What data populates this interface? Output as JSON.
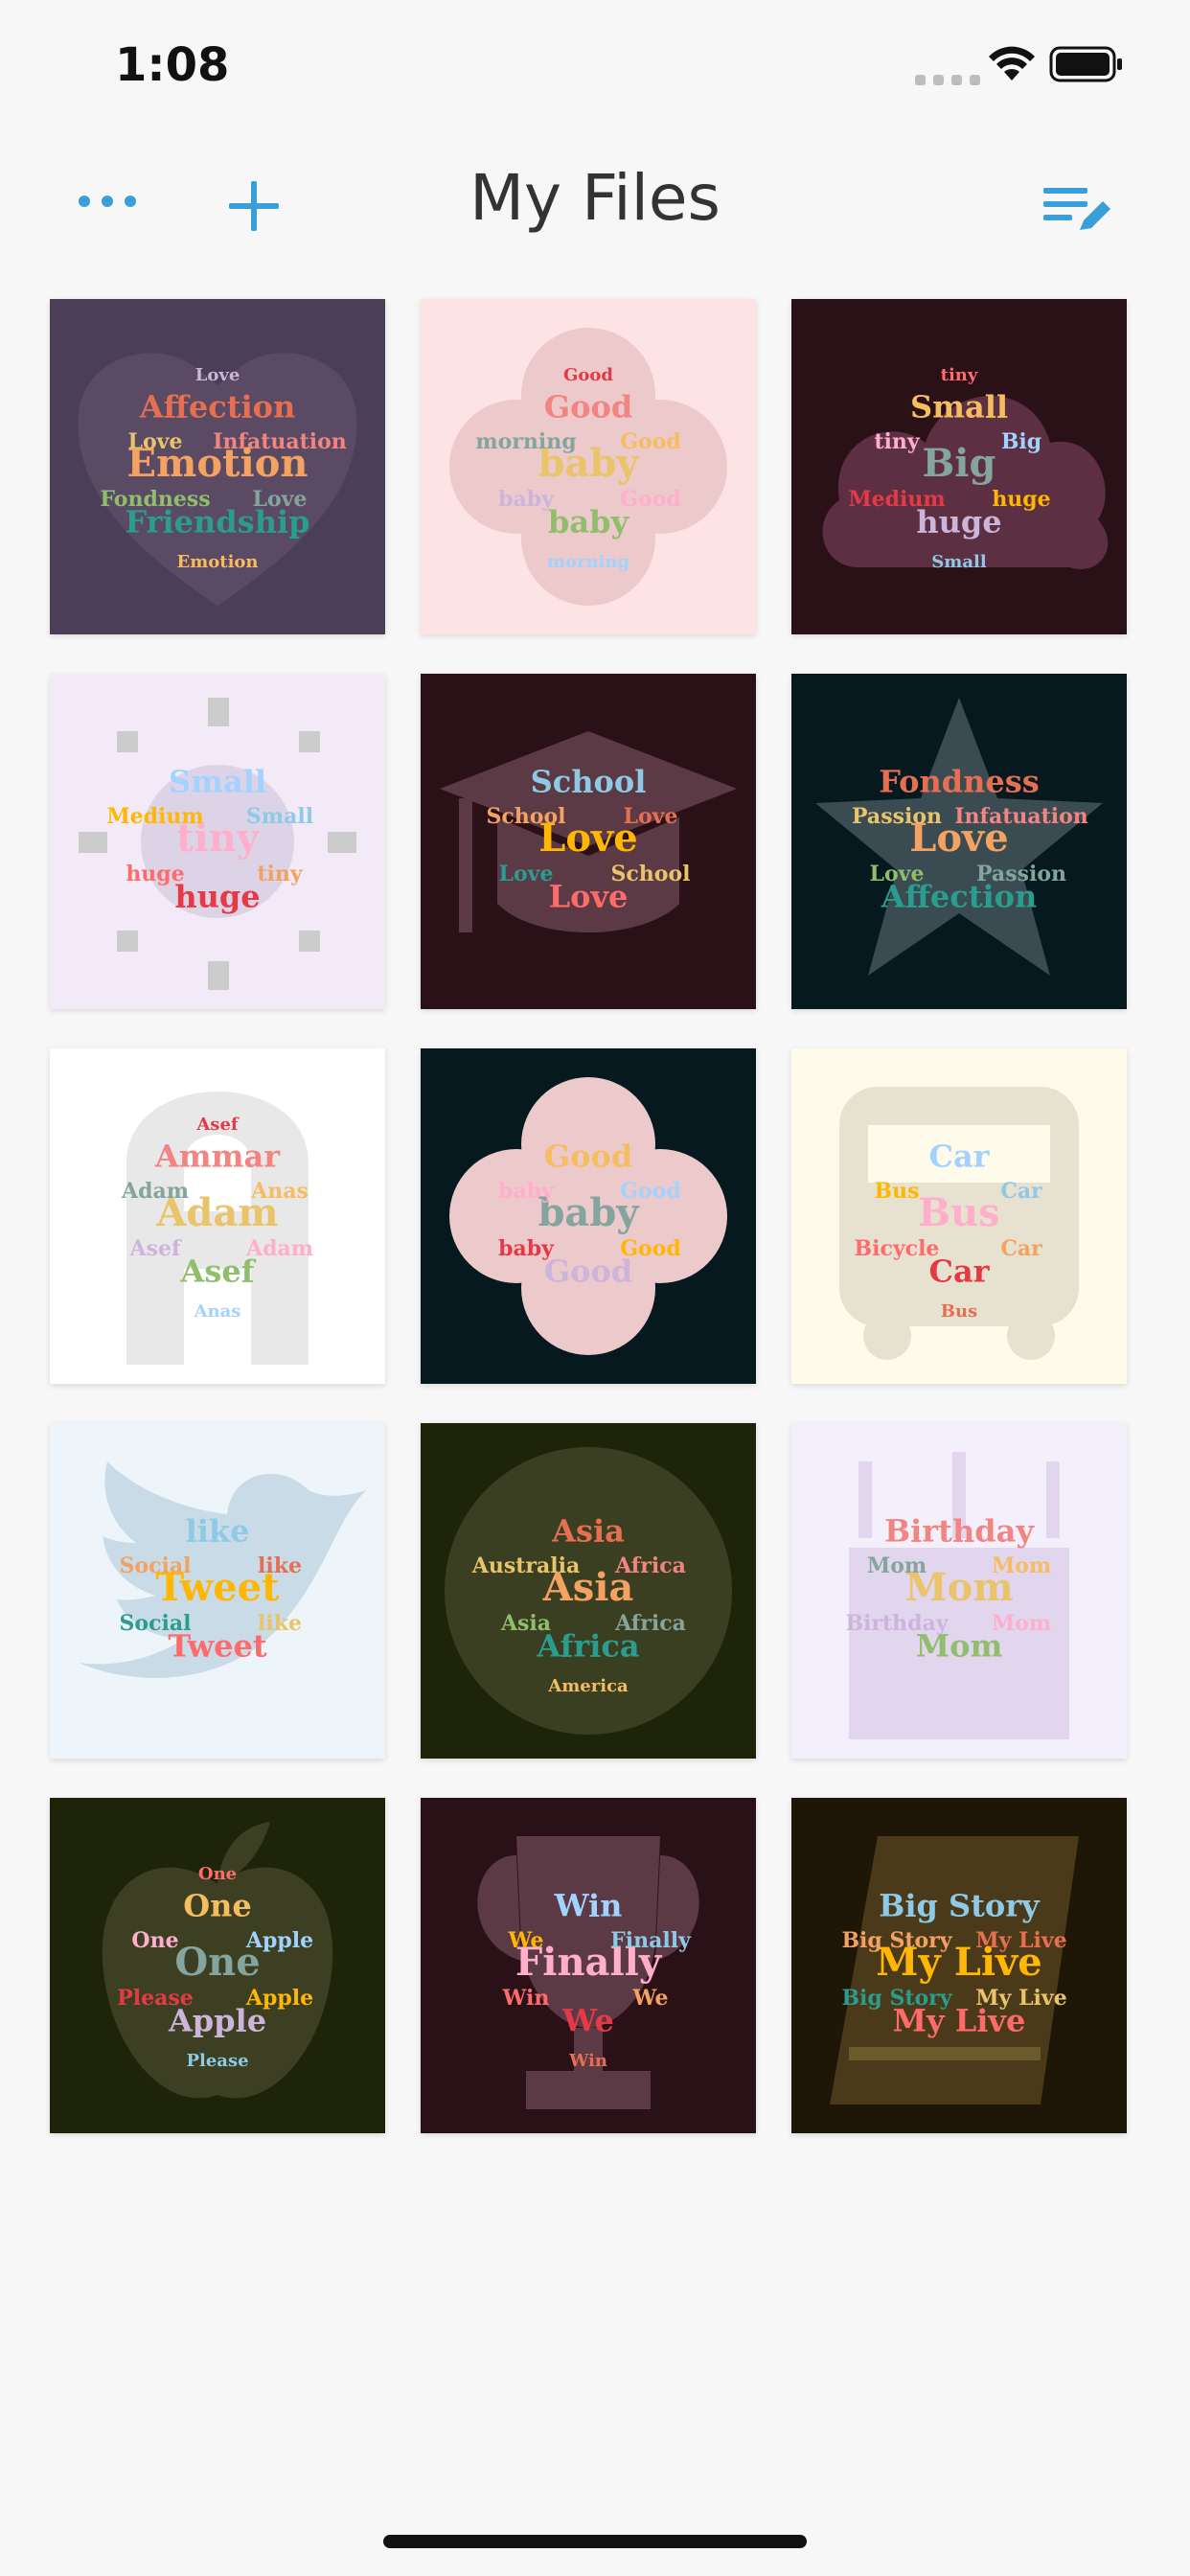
{
  "status_bar": {
    "time": "1:08"
  },
  "nav": {
    "title": "My Files",
    "more_icon": "ellipsis-icon",
    "add_icon": "plus-icon",
    "edit_icon": "list-edit-icon",
    "accent": "#3a9fd8"
  },
  "files": [
    {
      "name": "heart",
      "bg": "#4a3f57",
      "shape": "heart-shape",
      "words": [
        "Emotion",
        "Affection",
        "Friendship",
        "Love",
        "Infatuation",
        "Fondness",
        "Love",
        "Emotion",
        "Love"
      ]
    },
    {
      "name": "flower-pink",
      "bg": "#fde3e4",
      "shape": "flower-shape",
      "words": [
        "baby",
        "Good",
        "baby",
        "morning",
        "Good",
        "baby",
        "Good",
        "morning",
        "Good"
      ]
    },
    {
      "name": "cloud",
      "bg": "#2a1118",
      "shape": "cloud-shape",
      "words": [
        "Big",
        "Small",
        "huge",
        "tiny",
        "Big",
        "Medium",
        "huge",
        "Small",
        "tiny"
      ]
    },
    {
      "name": "sun-arm",
      "bg": "#f3eaf8",
      "shape": "sun-shape",
      "words": [
        "tiny",
        "Small",
        "huge",
        "Medium",
        "Small",
        "huge",
        "tiny"
      ]
    },
    {
      "name": "grad-cap",
      "bg": "#2a1118",
      "shape": "graduation-cap",
      "words": [
        "Love",
        "School",
        "Love",
        "School",
        "Love",
        "Love",
        "School"
      ]
    },
    {
      "name": "star",
      "bg": "#06191f",
      "shape": "star-shape",
      "words": [
        "Love",
        "Fondness",
        "Affection",
        "Passion",
        "Infatuation",
        "Love",
        "Passion"
      ]
    },
    {
      "name": "letter-a",
      "bg": "#ffffff",
      "shape": "letter-a",
      "words": [
        "Adam",
        "Ammar",
        "Asef",
        "Adam",
        "Anas",
        "Asef",
        "Adam",
        "Anas",
        "Asef"
      ]
    },
    {
      "name": "flower-dark",
      "bg": "#06191f",
      "shape": "flower-shape",
      "words": [
        "baby",
        "Good",
        "Good",
        "baby",
        "Good",
        "baby",
        "Good"
      ]
    },
    {
      "name": "bus",
      "bg": "#fffbeb",
      "shape": "bus-shape",
      "words": [
        "Bus",
        "Car",
        "Car",
        "Bus",
        "Car",
        "Bicycle",
        "Car",
        "Bus"
      ]
    },
    {
      "name": "bird",
      "bg": "#eef5fa",
      "shape": "bird-shape",
      "words": [
        "Tweet",
        "like",
        "Tweet",
        "Social",
        "like",
        "Social",
        "like"
      ]
    },
    {
      "name": "globe",
      "bg": "#1d2409",
      "shape": "globe-shape",
      "words": [
        "Asia",
        "Asia",
        "Africa",
        "Australia",
        "Africa",
        "Asia",
        "Africa",
        "America"
      ]
    },
    {
      "name": "cake",
      "bg": "#f3f0fb",
      "shape": "cake-shape",
      "words": [
        "Mom",
        "Birthday",
        "Mom",
        "Mom",
        "Mom",
        "Birthday",
        "Mom"
      ]
    },
    {
      "name": "apple",
      "bg": "#1d2409",
      "shape": "apple-shape",
      "words": [
        "One",
        "One",
        "Apple",
        "One",
        "Apple",
        "Please",
        "Apple",
        "Please",
        "One"
      ]
    },
    {
      "name": "trophy",
      "bg": "#2a1118",
      "shape": "trophy-shape",
      "words": [
        "Finally",
        "Win",
        "We",
        "We",
        "Finally",
        "Win",
        "We",
        "Win"
      ]
    },
    {
      "name": "book",
      "bg": "#1e1607",
      "shape": "book-shape",
      "words": [
        "My Live",
        "Big Story",
        "My Live",
        "Big Story",
        "My Live",
        "Big Story",
        "My Live"
      ]
    }
  ]
}
